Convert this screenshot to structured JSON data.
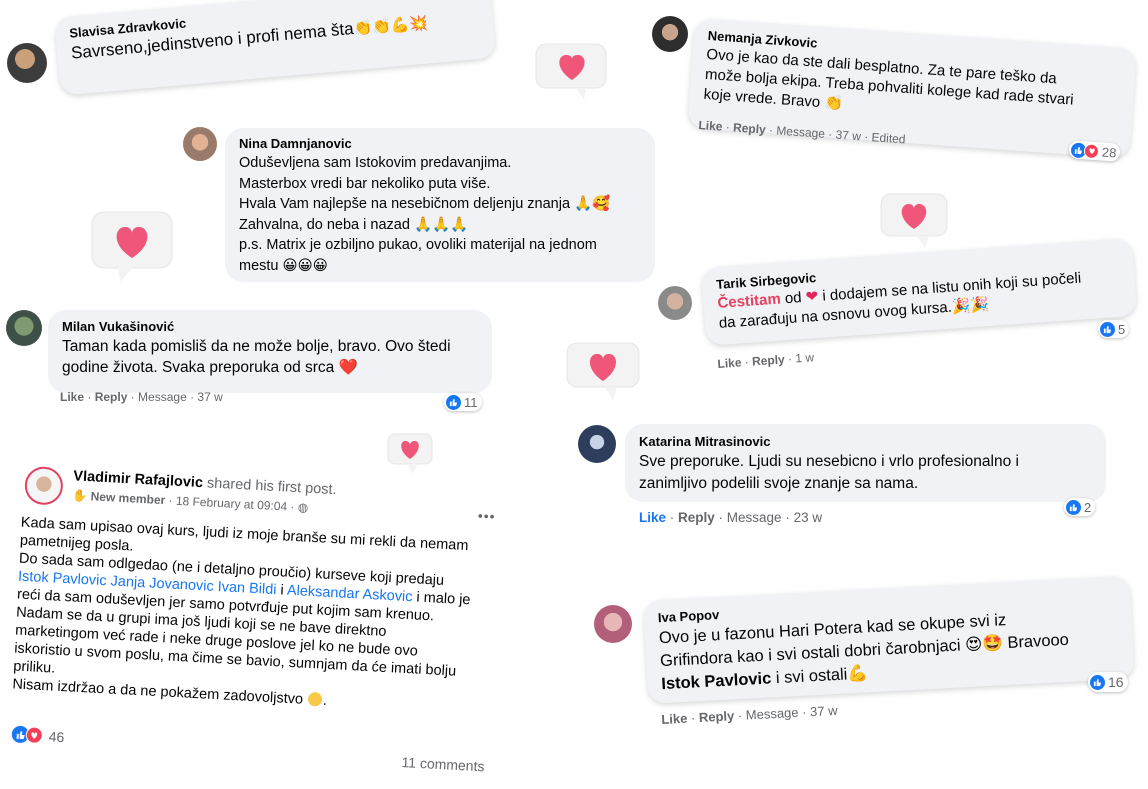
{
  "comments": [
    {
      "name": "Slavisa Zdravkovic",
      "text": "Savrseno,jedinstveno i profi nema šta",
      "emoji": "👏👏💪💥"
    },
    {
      "name": "Nina Damnjanovic",
      "lines": [
        "Oduševljena sam Istokovim predavanjima.",
        "Masterbox vredi bar nekoliko puta više.",
        "Hvala Vam najlepše na nesebičnom deljenju znanja",
        "Zahvalna, do neba i nazad",
        "p.s. Matrix je ozbiljno pukao, ovoliki materijal na jednom",
        "mestu"
      ],
      "emoji_line3": "🙏🥰",
      "emoji_line4": "🙏🙏🙏",
      "emoji_line6": "😀😀😀"
    },
    {
      "name": "Milan Vukašinović",
      "lines": [
        "Taman kada pomisliš da ne može bolje, bravo. Ovo štedi",
        "godine života. Svaka preporuka od srca"
      ],
      "emoji": "❤️",
      "meta": {
        "like": "Like",
        "reply": "Reply",
        "message": "Message",
        "time": "37 w"
      },
      "reactions": "11"
    },
    {
      "name": "Nemanja Zivkovic",
      "lines": [
        "Ovo je kao da ste dali besplatno. Za te pare teško da",
        "može bolja ekipa. Treba pohvaliti kolege kad rade stvari",
        "koje vrede. Bravo"
      ],
      "emoji": "👏",
      "meta": {
        "like": "Like",
        "reply": "Reply",
        "message": "Message",
        "time": "37 w",
        "edited": "Edited"
      },
      "reactions": "28"
    },
    {
      "name": "Tarik Sirbegovic",
      "highlight": "Čestitam",
      "text_a": " od ",
      "text_b": " i dodajem se na listu onih koji su počeli",
      "line2": "da zarađuju na osnovu ovog kursa.",
      "emoji": "🎉🎉",
      "meta": {
        "like": "Like",
        "reply": "Reply",
        "time": "1 w"
      },
      "reactions": "5"
    },
    {
      "name": "Katarina Mitrasinovic",
      "lines": [
        "Sve preporuke. Ljudi su nesebicno i vrlo profesionalno i",
        "zanimljivo podelili svoje znanje sa nama."
      ],
      "meta": {
        "like": "Like",
        "reply": "Reply",
        "message": "Message",
        "time": "23 w"
      },
      "reactions": "2"
    },
    {
      "name": "Iva Popov",
      "line1": "Ovo je u fazonu Hari Potera kad se okupe svi iz",
      "line2a": "Grifindora kao i svi ostali dobri čarobnjaci",
      "line2emoji": "😍🤩",
      "line2b": " Bravooo",
      "mention": "Istok Pavlovic",
      "line3b": " i svi ostali",
      "line3emoji": "💪",
      "meta": {
        "like": "Like",
        "reply": "Reply",
        "message": "Message",
        "time": "37 w"
      },
      "reactions": "16"
    }
  ],
  "post": {
    "author": "Vladimir Rafajlovic",
    "action": " shared his first post.",
    "badge": "New member",
    "date": " · 18 February at 09:04 · ",
    "more": "•••",
    "paragraph1": [
      "Kada sam upisao ovaj kurs, ljudi iz moje branše su mi rekli da nemam",
      "pametnijeg posla."
    ],
    "p2_line1": "Do sada sam odlgedao (ne i detaljno proučio) kurseve koji predaju",
    "p2_link1": "Istok Pavlovic",
    "p2_link2": "Janja Jovanovic",
    "p2_link3": "Ivan Bildi",
    "p2_and": " i ",
    "p2_link4": "Aleksandar Askovic",
    "p2_after": " i malo je",
    "p2_rest": [
      "reći da sam oduševljen jer samo potvrđuje put kojim sam krenuo.",
      "Nadam se da u grupi ima još ljudi koji se ne bave direktno",
      "marketingom već rade i neke druge poslove jel ko ne bude ovo",
      "iskoristio u svom poslu, ma čime se bavio, sumnjam da će imati bolju",
      "priliku."
    ],
    "last_line": "Nisam izdržao a da ne pokažem zadovoljstvo",
    "reactions": "46",
    "comments": "11 comments"
  }
}
